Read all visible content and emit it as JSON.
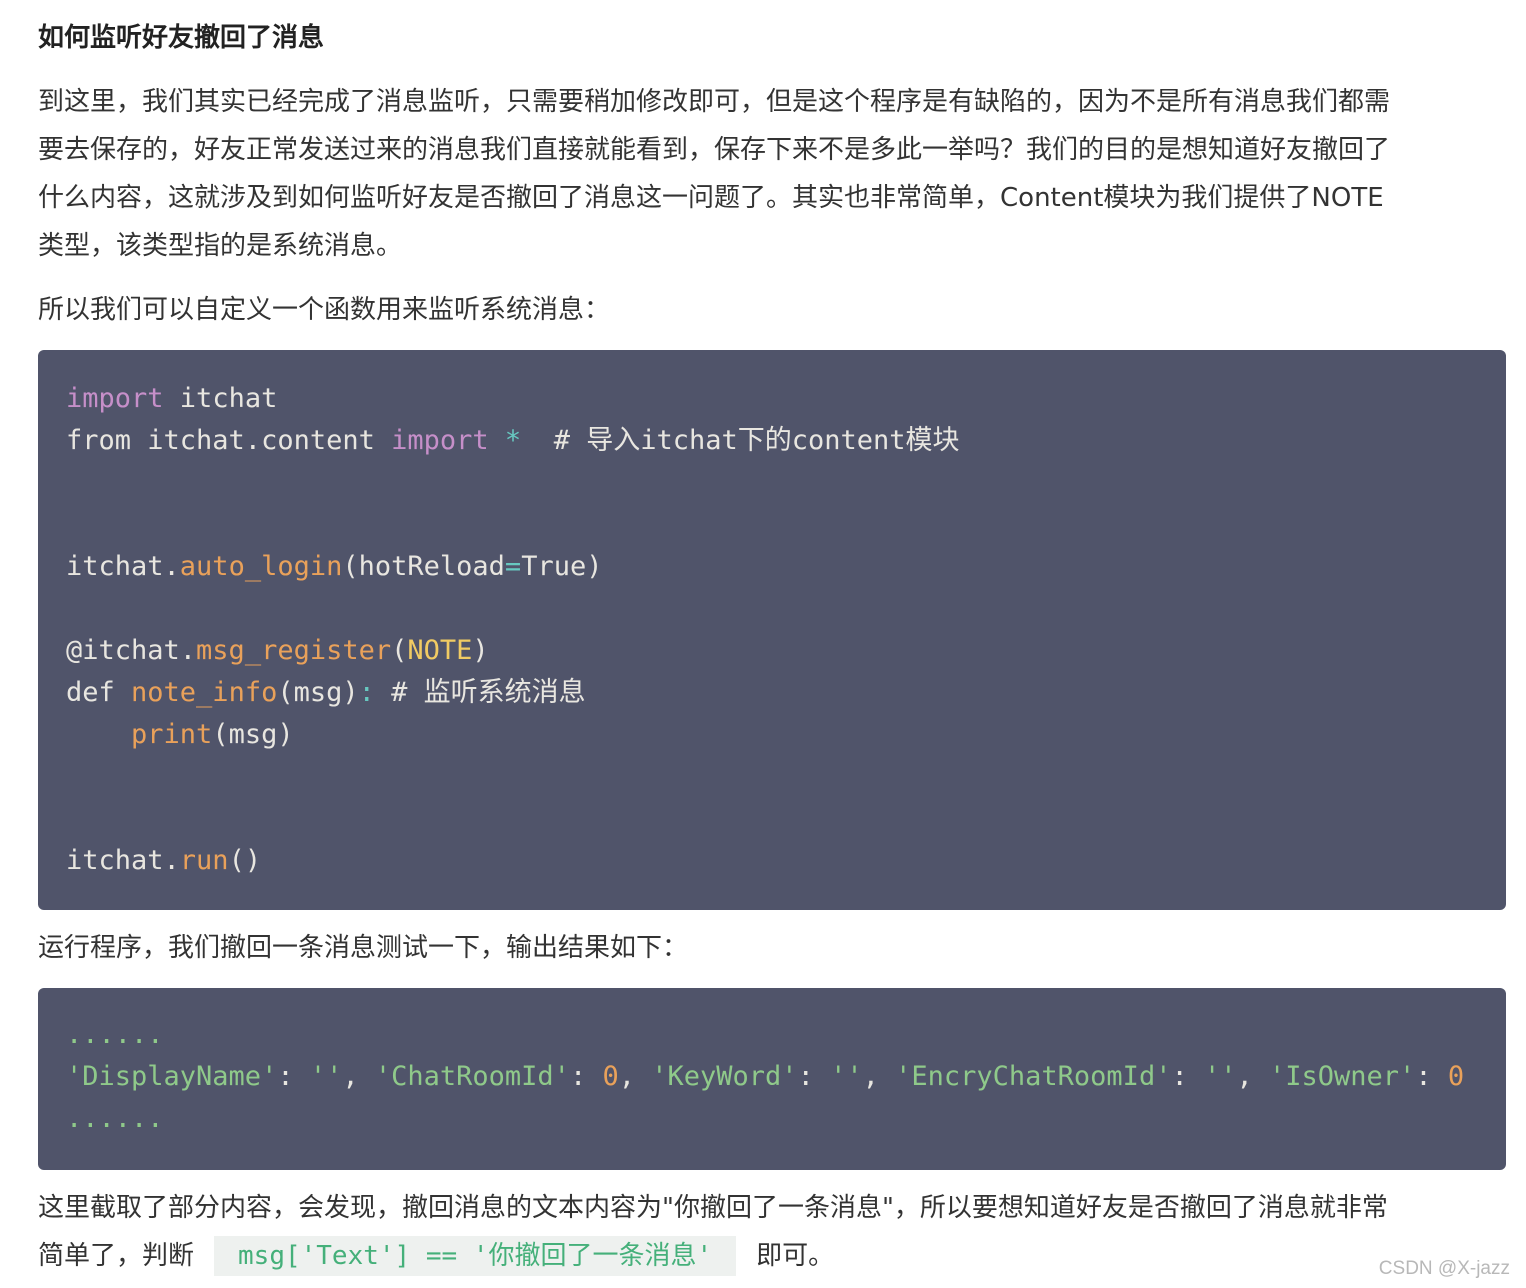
{
  "heading": "如何监听好友撤回了消息",
  "para1": [
    "到这里，我们其实已经完成了消息监听，只需要稍加修改即可，但是这个程序是有缺陷的，因为不是所有消息我们都需",
    "要去保存的，好友正常发送过来的消息我们直接就能看到，保存下来不是多此一举吗？我们的目的是想知道好友撤回了",
    "什么内容，这就涉及到如何监听好友是否撤回了消息这一问题了。其实也非常简单，Content模块为我们提供了NOTE",
    "类型，该类型指的是系统消息。"
  ],
  "para2": "所以我们可以自定义一个函数用来监听系统消息：",
  "code1": {
    "l1_kw": "import",
    "l1_rest": " itchat",
    "l2_a": "from itchat.content ",
    "l2_kw": "import",
    "l2_sp": " ",
    "l2_star": "*",
    "l2_cm": "  # 导入itchat下的content模块",
    "l5_a": "itchat.",
    "l5_fn": "auto_login",
    "l5_b": "(hotReload",
    "l5_eq": "=",
    "l5_c": "True)",
    "l7_a": "@itchat.",
    "l7_fn": "msg_register",
    "l7_b": "(",
    "l7_cls": "NOTE",
    "l7_c": ")",
    "l8_a": "def ",
    "l8_fn": "note_info",
    "l8_b": "(msg)",
    "l8_colon": ":",
    "l8_cm": " # 监听系统消息",
    "l9_ind": "    ",
    "l9_fn": "print",
    "l9_b": "(msg)",
    "l12_a": "itchat.",
    "l12_fn": "run",
    "l12_b": "()"
  },
  "para3": "运行程序，我们撤回一条消息测试一下，输出结果如下：",
  "code2": {
    "dots_top": "......",
    "s1": "'DisplayName'",
    "p1": ": ",
    "s2": "''",
    "p2": ", ",
    "s3": "'ChatRoomId'",
    "p3": ": ",
    "n1": "0",
    "p4": ", ",
    "s4": "'KeyWord'",
    "p5": ": ",
    "s5": "''",
    "p6": ", ",
    "s6": "'EncryChatRoomId'",
    "p7": ": ",
    "s7": "''",
    "p8": ", ",
    "s8": "'IsOwner'",
    "p9": ": ",
    "n2": "0",
    "dots_bottom": "......"
  },
  "para4": {
    "line1": "这里截取了部分内容，会发现，撤回消息的文本内容为\"你撤回了一条消息\"，所以要想知道好友是否撤回了消息就非常",
    "line2_a": "简单了，判断",
    "inline_code": "msg['Text'] == '你撤回了一条消息'",
    "line2_b": "即可。"
  },
  "watermark": "CSDN @X-jazz"
}
